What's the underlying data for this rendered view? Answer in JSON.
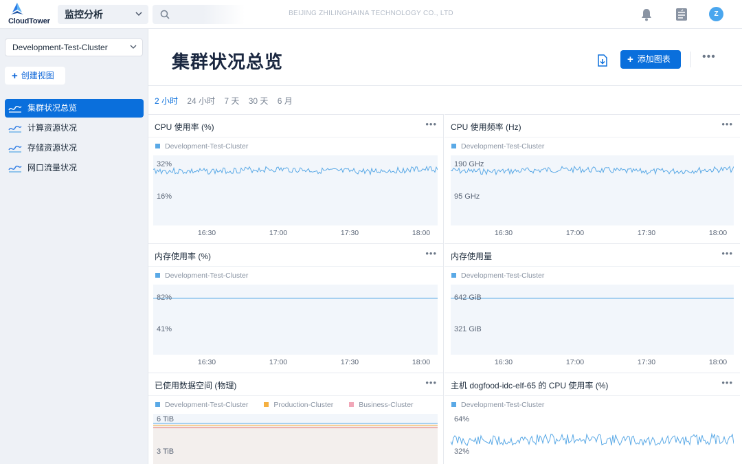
{
  "app": {
    "logo_text": "CloudTower",
    "module": "监控分析",
    "company": "BEIJING ZHILINGHAINA TECHNOLOGY CO., LTD",
    "avatar_letter": "Z",
    "accent": "#0a6fdc"
  },
  "sidebar": {
    "cluster": "Development-Test-Cluster",
    "create_view": "创建视图",
    "items": [
      {
        "label": "集群状况总览",
        "active": true
      },
      {
        "label": "计算资源状况",
        "active": false
      },
      {
        "label": "存储资源状况",
        "active": false
      },
      {
        "label": "网口流量状况",
        "active": false
      }
    ]
  },
  "main": {
    "title": "集群状况总览",
    "add_chart": "添加图表",
    "ranges": [
      "2 小时",
      "24 小时",
      "7 天",
      "30 天",
      "6 月"
    ],
    "active_range": 0
  },
  "colors": {
    "series_blue": "#5aa9e6",
    "series_orange": "#f5b041",
    "series_pink": "#f1a7b8",
    "series_red": "#e57373"
  },
  "panels": [
    {
      "title": "CPU 使用率 (%)",
      "legend": [
        "Development-Test-Cluster"
      ],
      "y_labels": [
        "32%",
        "16%"
      ],
      "x_labels": [
        "16:30",
        "17:00",
        "17:30",
        "18:00"
      ]
    },
    {
      "title": "CPU 使用频率 (Hz)",
      "legend": [
        "Development-Test-Cluster"
      ],
      "y_labels": [
        "190 GHz",
        "95 GHz"
      ],
      "x_labels": [
        "16:30",
        "17:00",
        "17:30",
        "18:00"
      ]
    },
    {
      "title": "内存使用率 (%)",
      "legend": [
        "Development-Test-Cluster"
      ],
      "y_labels": [
        "82%",
        "41%"
      ],
      "x_labels": [
        "16:30",
        "17:00",
        "17:30",
        "18:00"
      ]
    },
    {
      "title": "内存使用量",
      "legend": [
        "Development-Test-Cluster"
      ],
      "y_labels": [
        "642 GiB",
        "321 GiB"
      ],
      "x_labels": [
        "16:30",
        "17:00",
        "17:30",
        "18:00"
      ]
    },
    {
      "title": "已使用数据空间 (物理)",
      "legend": [
        "Development-Test-Cluster",
        "Production-Cluster",
        "Business-Cluster"
      ],
      "y_labels": [
        "6 TiB",
        "3 TiB"
      ],
      "x_labels": []
    },
    {
      "title": "主机 dogfood-idc-elf-65 的 CPU 使用率 (%)",
      "legend": [
        "Development-Test-Cluster"
      ],
      "y_labels": [
        "64%",
        "32%"
      ],
      "x_labels": []
    }
  ]
}
